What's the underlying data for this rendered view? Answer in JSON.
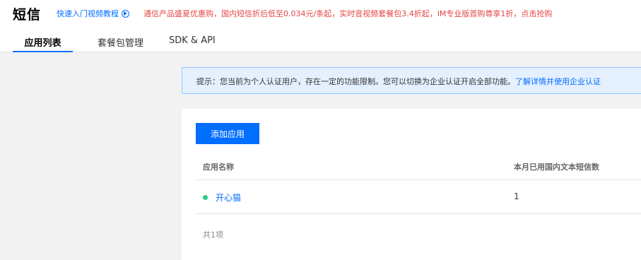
{
  "header": {
    "title": "短信",
    "tutorial_link": "快速入门视频教程",
    "promo": "通信产品盛夏优惠购，国内短信折后低至0.034元/条起，实时音视频套餐包3.4折起，IM专业版首购尊享1折，点击抢购"
  },
  "tabs": [
    {
      "label": "应用列表",
      "active": true
    },
    {
      "label": "套餐包管理",
      "active": false
    },
    {
      "label": "SDK & API",
      "active": false
    }
  ],
  "notice": {
    "text": "提示：您当前为个人认证用户，存在一定的功能限制。您可以切换为企业认证开启全部功能。",
    "link": "了解详情并使用企业认证"
  },
  "toolbar": {
    "add_button": "添加应用"
  },
  "table": {
    "columns": [
      "应用名称",
      "本月已用国内文本短信数"
    ],
    "rows": [
      {
        "name": "开心猫",
        "count": "1",
        "status_color": "#29cc85"
      }
    ],
    "total": "共1项"
  },
  "colors": {
    "accent": "#006eff",
    "promo": "#e54545",
    "status_ok": "#29cc85",
    "notice_bg": "#e5f0ff"
  },
  "icons": {
    "tutorial": "play-circle-icon"
  }
}
